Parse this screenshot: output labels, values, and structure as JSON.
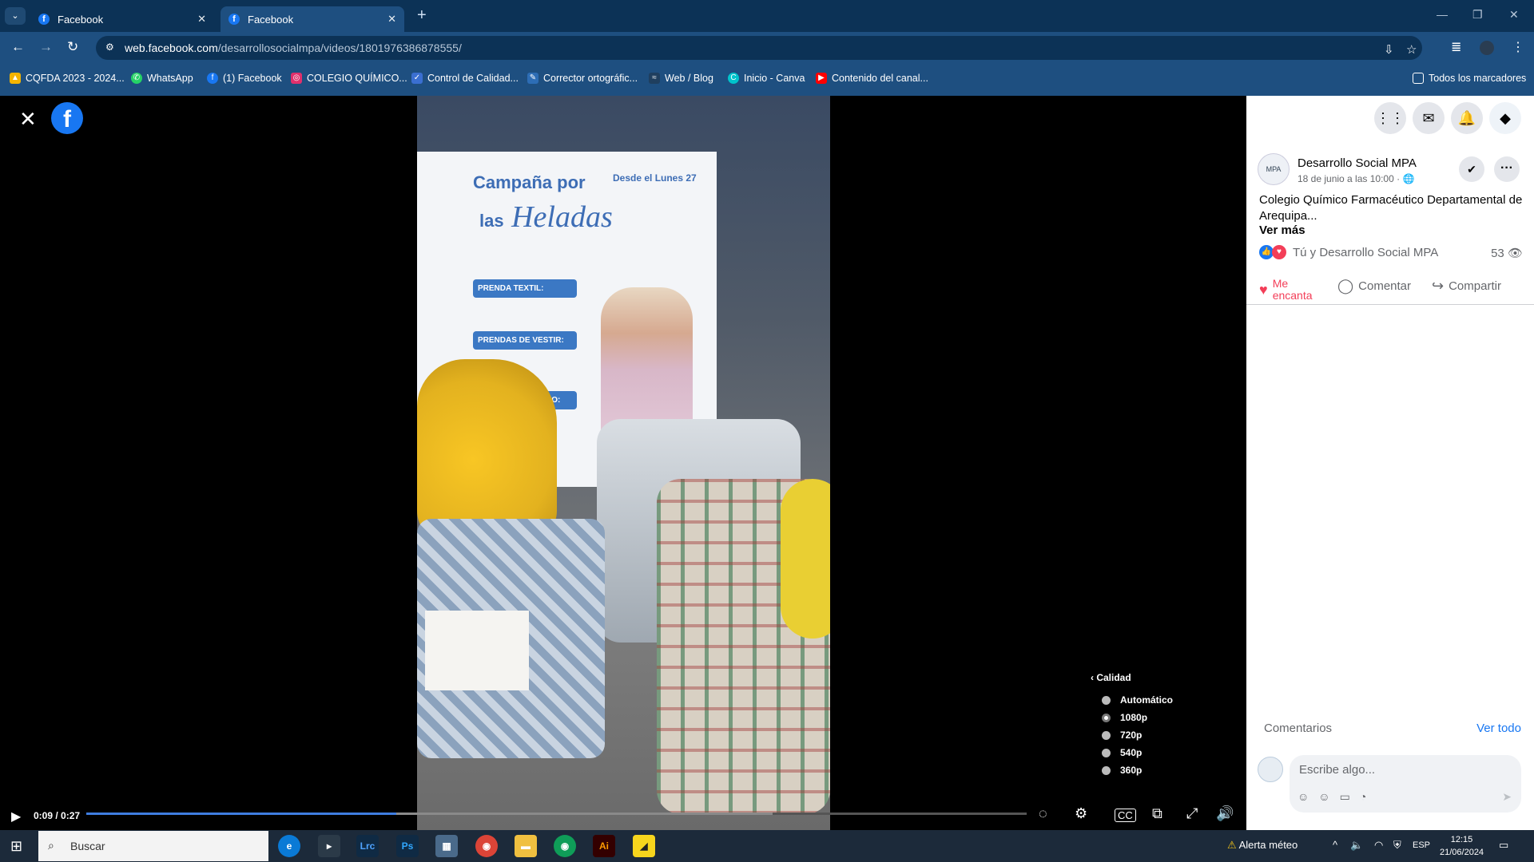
{
  "browser": {
    "tabs": [
      {
        "label": "Facebook",
        "active": false
      },
      {
        "label": "Facebook",
        "active": true
      }
    ],
    "url_host": "web.facebook.com",
    "url_path": "/desarrollosocialmpa/videos/1801976386878555/",
    "bookmarks": [
      {
        "label": "CQFDA 2023 - 2024...",
        "icon": "drive-icon",
        "color": "#f4b400"
      },
      {
        "label": "WhatsApp",
        "icon": "whatsapp-icon",
        "color": "#25d366"
      },
      {
        "label": "(1) Facebook",
        "icon": "facebook-icon",
        "color": "#1877f2"
      },
      {
        "label": "COLEGIO QUÍMICO...",
        "icon": "instagram-icon",
        "color": "#e1306c"
      },
      {
        "label": "Control de Calidad...",
        "icon": "check-icon",
        "color": "#3a6fd1"
      },
      {
        "label": "Corrector ortográfic...",
        "icon": "corrector-icon",
        "color": "#2d6db5"
      },
      {
        "label": "Web / Blog",
        "icon": "blog-icon",
        "color": "#1f3f5f"
      },
      {
        "label": "Inicio - Canva",
        "icon": "canva-icon",
        "color": "#00c4cc"
      },
      {
        "label": "Contenido del canal...",
        "icon": "youtube-icon",
        "color": "#ff0000"
      }
    ],
    "all_bookmarks_label": "Todos los marcadores"
  },
  "viewer": {
    "poster_text": {
      "line1": "Campaña por",
      "line2": "Heladas",
      "line2_prefix": "las",
      "date_badge": "Desde el Lunes 27",
      "panel1": "PRENDA TEXTIL:",
      "panel2": "PRENDAS DE VESTIR:",
      "panel3": "PUNTOS DE ACOPIO:"
    },
    "time": "0:09 / 0:27",
    "progress": 0.33,
    "buffered": 0.73,
    "quality": {
      "title": "Calidad",
      "options": [
        "Automático",
        "1080p",
        "720p",
        "540p",
        "360p"
      ],
      "selected": "1080p"
    }
  },
  "post": {
    "page_name": "Desarrollo Social MPA",
    "date": "18 de junio a las 10:00 ·",
    "text": "Colegio Químico Farmacéutico Departamental de Arequipa...",
    "see_more": "Ver más",
    "reactions_text": "Tú y Desarrollo Social MPA",
    "views": "53",
    "actions": {
      "love": "Me encanta",
      "comment": "Comentar",
      "share": "Compartir"
    },
    "comments_label": "Comentarios",
    "see_all": "Ver todo",
    "comment_placeholder": "Escribe algo..."
  },
  "taskbar": {
    "search_label": "Buscar",
    "weather_alert": "Alerta méteo",
    "lang": "ESP",
    "time": "12:15",
    "date": "21/06/2024"
  },
  "colors": {
    "chrome_dark": "#0c3256",
    "chrome": "#1e4f80",
    "facebook_blue": "#1877f2",
    "love_red": "#f33e58"
  }
}
